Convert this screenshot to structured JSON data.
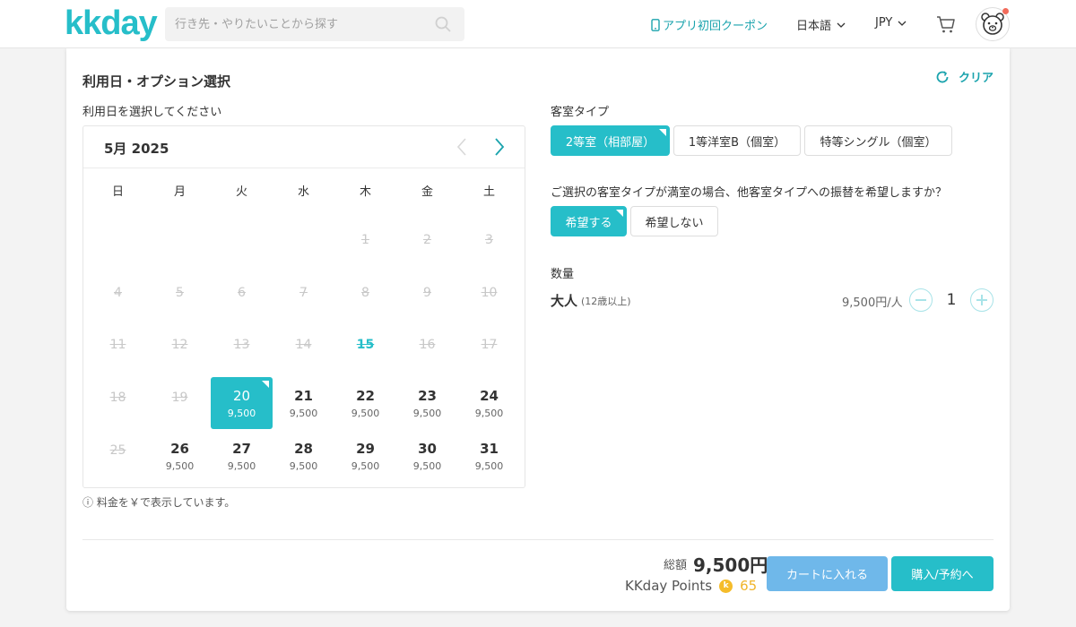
{
  "header": {
    "logo": "kkday",
    "search_placeholder": "行き先・やりたいことから探す",
    "coupon_label": "アプリ初回クーポン",
    "language": "日本語",
    "currency": "JPY"
  },
  "booking": {
    "title": "利用日・オプション選択",
    "clear_label": "クリア",
    "date_label": "利用日を選択してください",
    "month_label": "5月 2025",
    "weekdays": [
      "日",
      "月",
      "火",
      "水",
      "木",
      "金",
      "土"
    ],
    "price_note": "ⓘ 料金を￥で表示しています。",
    "days": [
      {
        "d": "1",
        "state": "past",
        "price": ""
      },
      {
        "d": "2",
        "state": "past",
        "price": ""
      },
      {
        "d": "3",
        "state": "past",
        "price": ""
      },
      {
        "d": "4",
        "state": "past",
        "price": ""
      },
      {
        "d": "5",
        "state": "past",
        "price": ""
      },
      {
        "d": "6",
        "state": "past",
        "price": ""
      },
      {
        "d": "7",
        "state": "past",
        "price": ""
      },
      {
        "d": "8",
        "state": "past",
        "price": ""
      },
      {
        "d": "9",
        "state": "past",
        "price": ""
      },
      {
        "d": "10",
        "state": "past",
        "price": ""
      },
      {
        "d": "11",
        "state": "past",
        "price": ""
      },
      {
        "d": "12",
        "state": "past",
        "price": ""
      },
      {
        "d": "13",
        "state": "past",
        "price": ""
      },
      {
        "d": "14",
        "state": "past",
        "price": ""
      },
      {
        "d": "15",
        "state": "today",
        "price": ""
      },
      {
        "d": "16",
        "state": "past",
        "price": ""
      },
      {
        "d": "17",
        "state": "past",
        "price": ""
      },
      {
        "d": "18",
        "state": "past",
        "price": ""
      },
      {
        "d": "19",
        "state": "past",
        "price": ""
      },
      {
        "d": "20",
        "state": "sel",
        "price": "9,500"
      },
      {
        "d": "21",
        "state": "avail",
        "price": "9,500"
      },
      {
        "d": "22",
        "state": "avail",
        "price": "9,500"
      },
      {
        "d": "23",
        "state": "avail",
        "price": "9,500"
      },
      {
        "d": "24",
        "state": "avail",
        "price": "9,500"
      },
      {
        "d": "25",
        "state": "past",
        "price": ""
      },
      {
        "d": "26",
        "state": "avail",
        "price": "9,500"
      },
      {
        "d": "27",
        "state": "avail",
        "price": "9,500"
      },
      {
        "d": "28",
        "state": "avail",
        "price": "9,500"
      },
      {
        "d": "29",
        "state": "avail",
        "price": "9,500"
      },
      {
        "d": "30",
        "state": "avail",
        "price": "9,500"
      },
      {
        "d": "31",
        "state": "avail",
        "price": "9,500"
      }
    ]
  },
  "options": {
    "room_type_label": "客室タイプ",
    "room_types": [
      "2等室（相部屋）",
      "1等洋室B（個室）",
      "特等シングル（個室）"
    ],
    "room_selected": "2等室（相部屋）",
    "transfer_question": "ご選択の客室タイプが満室の場合、他客室タイプへの振替を希望しますか？",
    "transfer_options": [
      "希望する",
      "希望しない"
    ],
    "transfer_selected": "希望する",
    "quantity_label": "数量",
    "adult_label": "大人",
    "adult_age": "(12歳以上)",
    "adult_price": "9,500円/人",
    "adult_count": "1"
  },
  "footer": {
    "total_label": "総額",
    "total_value": "9,500円",
    "points_label": "KKday Points",
    "points_value": "65",
    "cart_button": "カートに入れる",
    "buy_button": "購入/予約へ"
  },
  "colors": {
    "accent": "#26bec9",
    "cart_button": "#6fb8ea",
    "points": "#f0b429"
  }
}
